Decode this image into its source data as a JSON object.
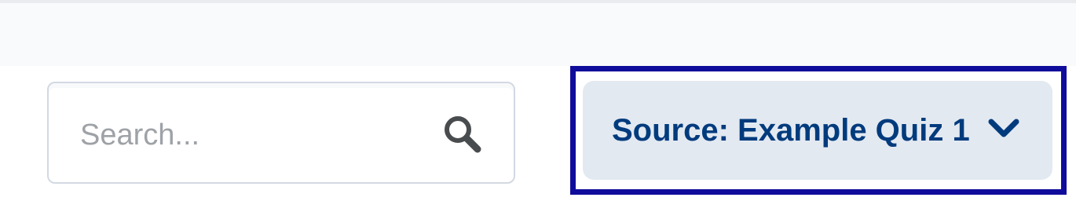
{
  "search": {
    "placeholder": "Search...",
    "value": ""
  },
  "source_selector": {
    "label": "Source: Example Quiz 1",
    "focused": true
  },
  "icons": {
    "search": "search-icon",
    "chevron": "chevron-down-icon"
  },
  "colors": {
    "focus_ring": "#100c9b",
    "button_bg": "#e3e9f1",
    "button_text": "#003b7d",
    "input_border": "#d3d9e3",
    "placeholder": "#9ea2a7"
  }
}
